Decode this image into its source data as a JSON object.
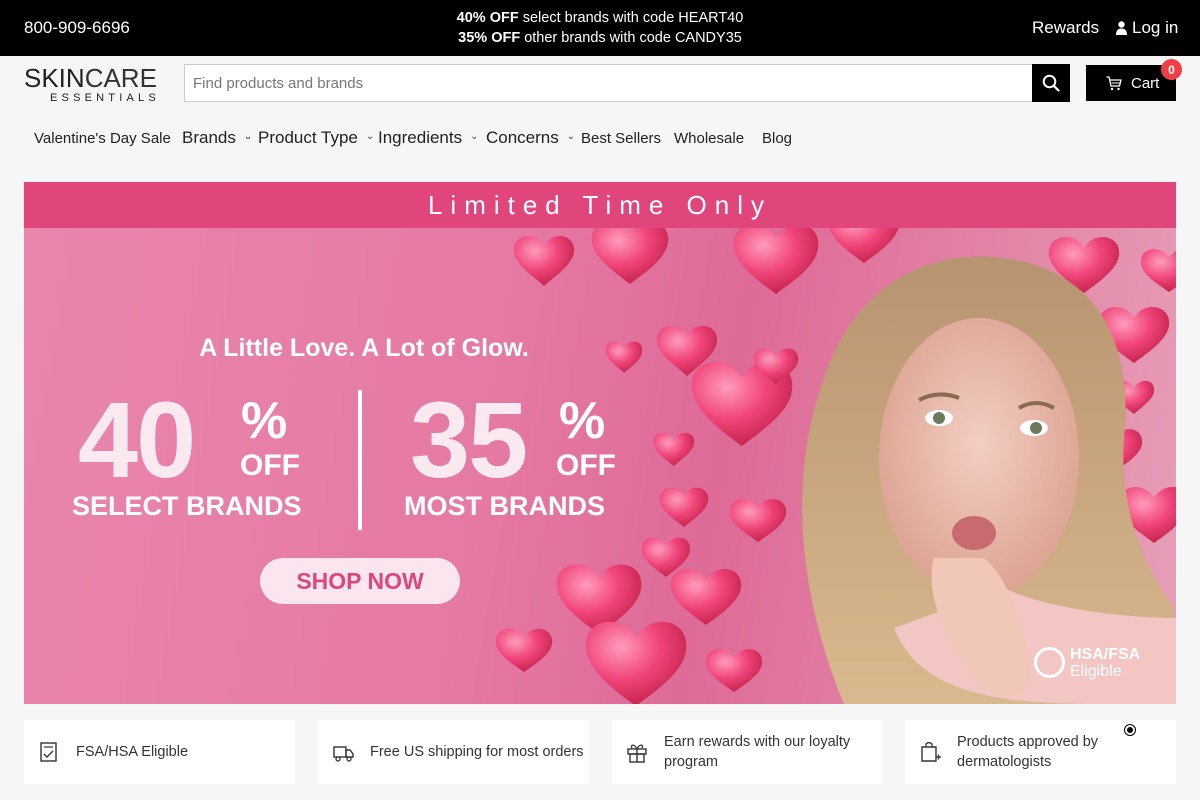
{
  "topbar": {
    "phone": "800-909-6696",
    "promo1_bold": "40% OFF",
    "promo1_rest": " select brands with code HEART40",
    "promo2_bold": "35% OFF",
    "promo2_rest": " other brands with code CANDY35",
    "rewards": "Rewards",
    "login": "Log in"
  },
  "header": {
    "logo_line1_a": "SKIN",
    "logo_line1_b": "CARE",
    "logo_line2": "ESSENTIALS",
    "search_placeholder": "Find products and brands",
    "cart_label": "Cart",
    "cart_count": "0"
  },
  "nav": {
    "items": [
      {
        "label": "Valentine's Day Sale"
      },
      {
        "label": "Brands"
      },
      {
        "label": "Product Type"
      },
      {
        "label": "Ingredients"
      },
      {
        "label": "Concerns"
      },
      {
        "label": "Best Sellers"
      },
      {
        "label": "Wholesale"
      },
      {
        "label": "Blog"
      }
    ]
  },
  "hero": {
    "strip": "Limited Time Only",
    "tagline": "A Little Love. A Lot of Glow.",
    "offer1_num": "40",
    "offer1_pct": "%",
    "offer1_off": "OFF",
    "offer1_sub": "SELECT BRANDS",
    "offer2_num": "35",
    "offer2_pct": "%",
    "offer2_off": "OFF",
    "offer2_sub": "MOST BRANDS",
    "cta": "SHOP NOW",
    "badge_line1": "HSA/FSA",
    "badge_line2": "Eligible"
  },
  "features": [
    {
      "icon": "receipt-check-icon",
      "text": "FSA/HSA Eligible"
    },
    {
      "icon": "delivery-truck-icon",
      "text": "Free US shipping for most orders"
    },
    {
      "icon": "gift-icon",
      "text": "Earn rewards with our loyalty program"
    },
    {
      "icon": "shopping-bag-plus-icon",
      "text": "Products approved by dermatologists"
    }
  ],
  "colors": {
    "topbar_bg": "#000000",
    "hero_strip": "#e0467c",
    "hero_pink": "#e57aa4",
    "cart_badge": "#ef3e46"
  }
}
